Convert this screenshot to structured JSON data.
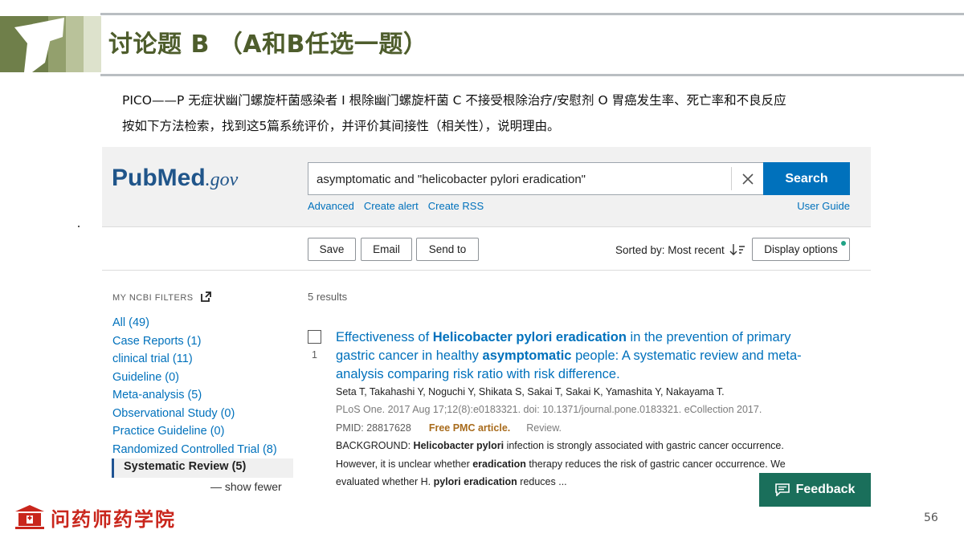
{
  "slide": {
    "title": "讨论题 B （A和B任选一题）",
    "desc_line1": "PICO——P 无症状幽门螺旋杆菌感染者 I 根除幽门螺旋杆菌 C 不接受根除治疗/安慰剂 O 胃癌发生率、死亡率和不良反应",
    "desc_line2": "按如下方法检索，找到这5篇系统评价，并评价其间接性（相关性），说明理由。",
    "page_number": "56",
    "footer_brand": "问药师药学院",
    "colors": {
      "title": "#4e5d2c",
      "brand_red": "#c9261c"
    }
  },
  "pubmed": {
    "logo": {
      "pub": "Pub",
      "med": "Med",
      "gov": ".gov"
    },
    "search": {
      "value": "asymptomatic and \"helicobacter pylori eradication\"",
      "button": "Search",
      "clear_icon": "close-icon"
    },
    "links": [
      "Advanced",
      "Create alert",
      "Create RSS"
    ],
    "user_guide": "User Guide",
    "toolbar": {
      "save": "Save",
      "email": "Email",
      "send_to": "Send to",
      "sort": "Sorted by: Most recent",
      "display": "Display options"
    },
    "filters_title": "MY NCBI FILTERS",
    "filters": [
      "All (49)",
      "Case Reports (1)",
      "clinical trial (11)",
      "Guideline (0)",
      "Meta-analysis (5)",
      "Observational Study (0)",
      "Practice Guideline (0)",
      "Randomized Controlled Trial (8)",
      "Systematic Review (5)"
    ],
    "active_filter": "Systematic Review (5)",
    "show_fewer": "show fewer",
    "results_count": "5 results",
    "result": {
      "number": "1",
      "title_parts": [
        "Effectiveness of ",
        "Helicobacter pylori eradication",
        " in the prevention of primary gastric cancer in healthy ",
        "asymptomatic",
        " people: A systematic review and meta-analysis comparing risk ratio with risk difference."
      ],
      "authors": "Seta T, Takahashi Y, Noguchi Y, Shikata S, Sakai T, Sakai K, Yamashita Y, Nakayama T.",
      "journal": "PLoS One. 2017 Aug 17;12(8):e0183321. doi: 10.1371/journal.pone.0183321. eCollection 2017.",
      "pmid": "PMID: 28817628",
      "free_pmc": "Free PMC article.",
      "review": "Review.",
      "snippet1": [
        "BACKGROUND: ",
        "Helicobacter pylori",
        " infection is strongly associated with gastric cancer occurrence."
      ],
      "snippet2": [
        "However, it is unclear whether ",
        "eradication",
        " therapy reduces the risk of gastric cancer occurrence. We"
      ],
      "snippet3": [
        "evaluated whether H. ",
        "pylori eradication",
        " reduces ..."
      ]
    },
    "feedback": "Feedback",
    "colors": {
      "link": "#0071bc",
      "search_button": "#0071bc",
      "feedback": "#1a6f5b",
      "free_pmc": "#a86b1c"
    }
  }
}
